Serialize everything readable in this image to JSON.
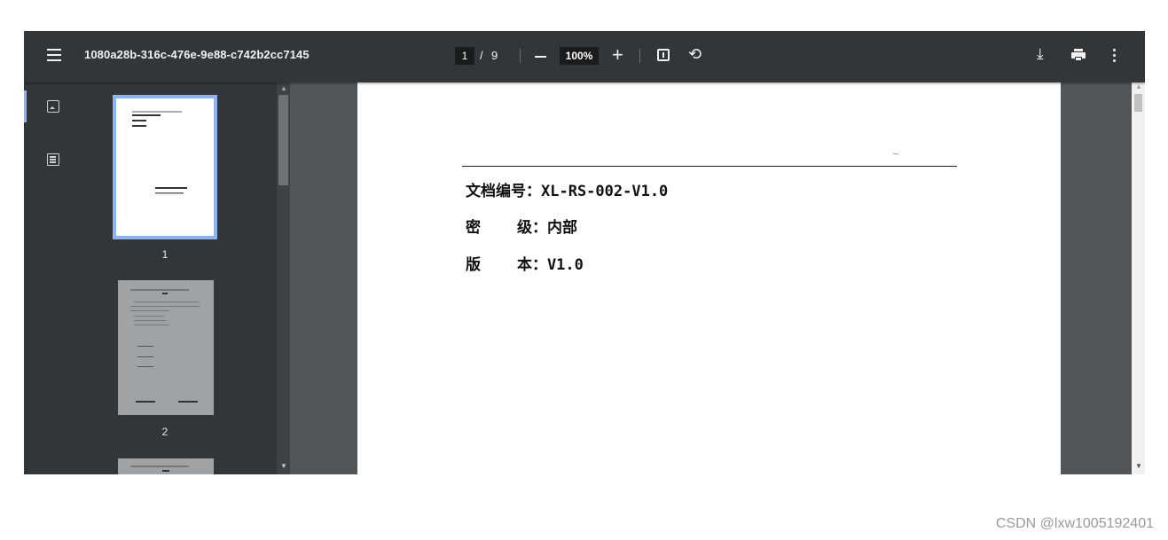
{
  "toolbar": {
    "menu_icon": "hamburger-icon",
    "title": "1080a28b-316c-476e-9e88-c742b2cc7145",
    "page_current": "1",
    "page_separator": "/",
    "page_total": "9",
    "zoom": "100%",
    "zoom_in_glyph": "+",
    "rotate_glyph": "⟲",
    "download_glyph": "⤓",
    "icons": [
      "zoom-out-icon",
      "zoom-in-icon",
      "fit-page-icon",
      "rotate-icon",
      "download-icon",
      "print-icon",
      "more-vert-icon"
    ]
  },
  "sidebar": {
    "tabs": [
      "thumbnails-icon",
      "outline-icon"
    ],
    "thumbnails": [
      {
        "label": "1",
        "active": true
      },
      {
        "label": "2",
        "active": false
      }
    ]
  },
  "document": {
    "lines": [
      "文档编号：XL-RS-002-V1.0",
      "密    级：内部",
      "版    本：V1.0"
    ]
  },
  "watermark": "CSDN @lxw1005192401",
  "colors": {
    "toolbar_bg": "#323639",
    "viewer_bg": "#525659",
    "accent": "#8ab4f8"
  }
}
